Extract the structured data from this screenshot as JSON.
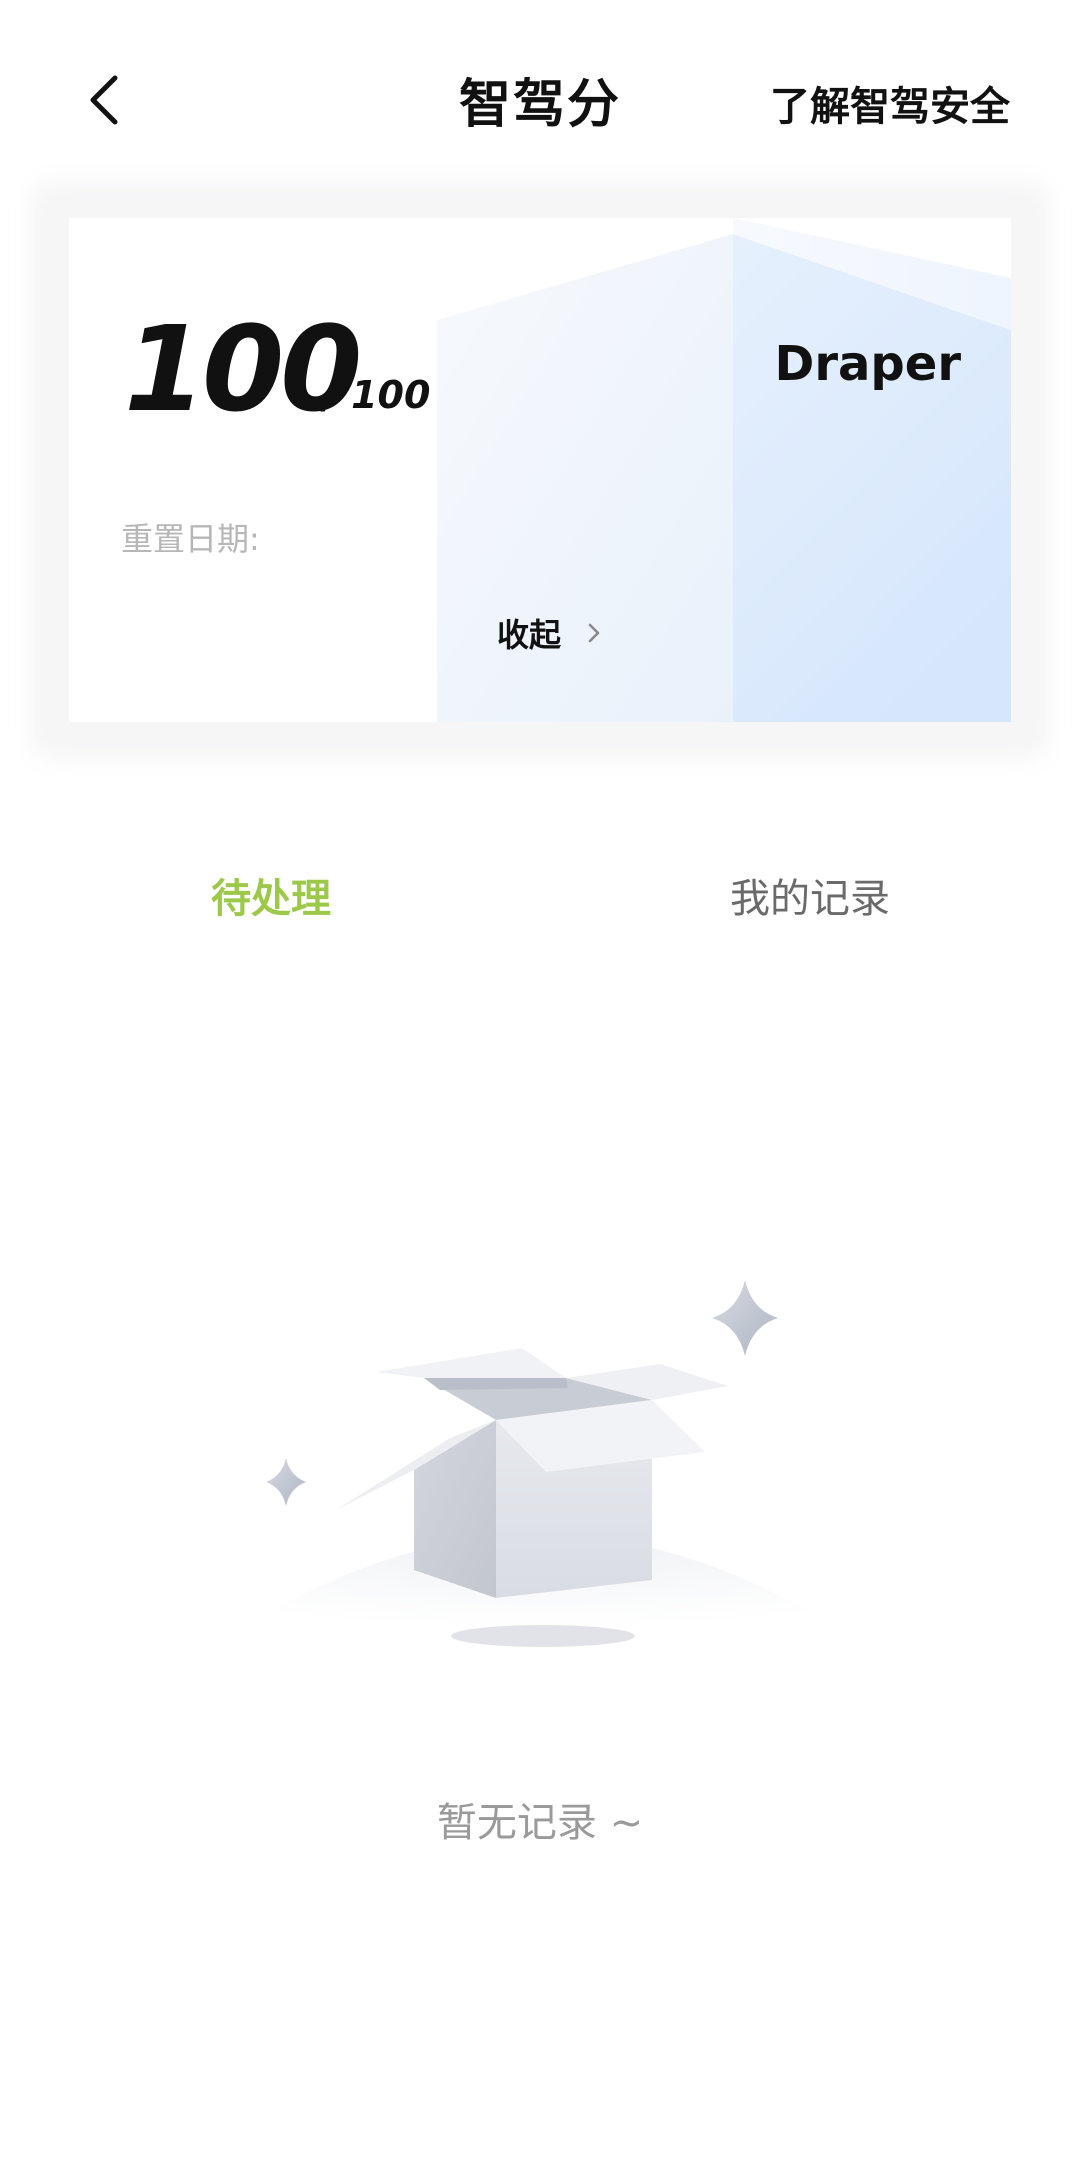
{
  "header": {
    "title": "智驾分",
    "info_link": "了解智驾安全",
    "back_icon": "chevron-left-icon"
  },
  "score_card": {
    "score": "100",
    "max_score": "/ 100",
    "username": "Draper",
    "reset_label": "重置日期:",
    "collapse_label": "收起",
    "collapse_icon": "chevron-right-icon"
  },
  "tabs": [
    {
      "label": "待处理",
      "active": true
    },
    {
      "label": "我的记录",
      "active": false
    }
  ],
  "empty_state": {
    "message": "暂无记录 ~",
    "icon": "open-box-icon"
  },
  "colors": {
    "accent": "#9dc94b",
    "text": "#111111",
    "muted": "#9a9a9a"
  }
}
